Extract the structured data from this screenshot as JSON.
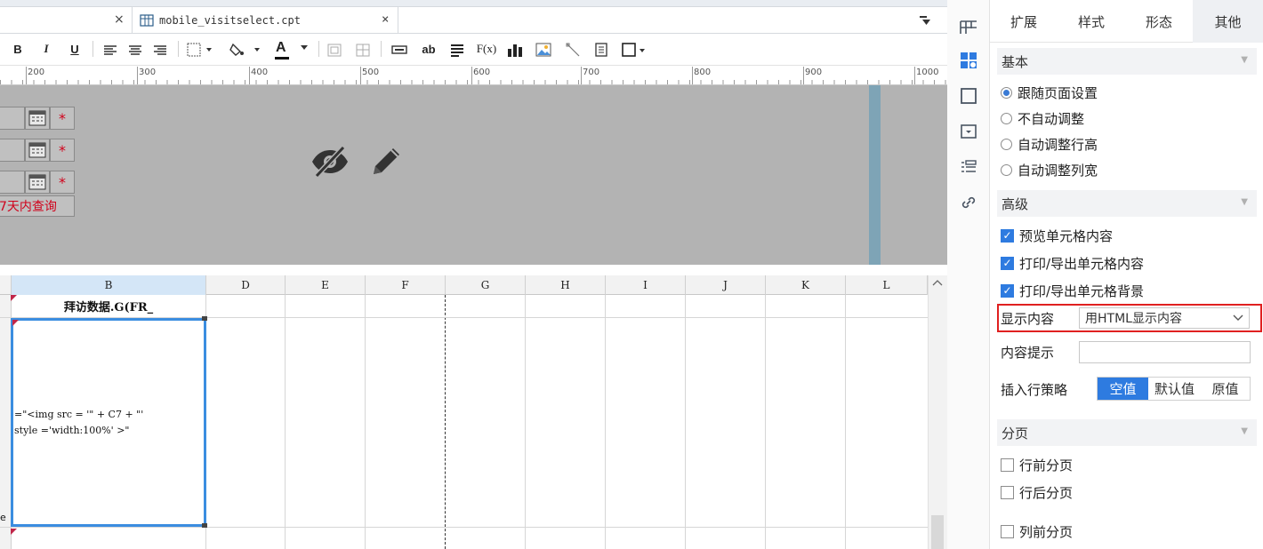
{
  "tabs": {
    "prev_close": "×",
    "file_name": "mobile_visitselect.cpt",
    "file_close": "×"
  },
  "toolbar": {
    "bold": "B",
    "italic": "I",
    "underline": "U",
    "font_color": "A",
    "text_field": "ab",
    "formula": "F(x)"
  },
  "ruler": {
    "labels": [
      "200",
      "300",
      "400",
      "500",
      "600",
      "700",
      "800",
      "900",
      "1000"
    ]
  },
  "form": {
    "required_mark": "*",
    "query_label": "7天内查询"
  },
  "grid": {
    "columns": [
      "B",
      "D",
      "E",
      "F",
      "G",
      "H",
      "I",
      "J",
      "K",
      "L"
    ],
    "header_cell": "拜访数据.G(FR_",
    "formula_line1": "=\"<img src = '\" + C7 + \"'",
    "formula_line2": "style ='width:100%' >\"",
    "side_glyph": "e"
  },
  "panel": {
    "tabs": [
      "扩展",
      "样式",
      "形态",
      "其他"
    ],
    "active_tab": "其他",
    "basic": {
      "title": "基本",
      "options": [
        "跟随页面设置",
        "不自动调整",
        "自动调整行高",
        "自动调整列宽"
      ],
      "selected_index": 0
    },
    "advanced": {
      "title": "高级",
      "checks": [
        "预览单元格内容",
        "打印/导出单元格内容",
        "打印/导出单元格背景"
      ],
      "display_label": "显示内容",
      "display_value": "用HTML显示内容",
      "tooltip_label": "内容提示",
      "tooltip_value": "",
      "insert_label": "插入行策略",
      "insert_options": [
        "空值",
        "默认值",
        "原值"
      ],
      "insert_selected": "空值"
    },
    "paging": {
      "title": "分页",
      "checks": [
        "行前分页",
        "行后分页",
        "列前分页"
      ]
    }
  },
  "colors": {
    "accent": "#2e7be0",
    "highlight_border": "#e02020",
    "canvas_gray": "#b3b3b3",
    "required": "#d0021b"
  },
  "icons": [
    "eye-slash-icon",
    "pencil-icon",
    "grid-layout-icon",
    "widget-icon",
    "border-icon",
    "dropdown-box-icon",
    "list-icon",
    "link-icon"
  ]
}
